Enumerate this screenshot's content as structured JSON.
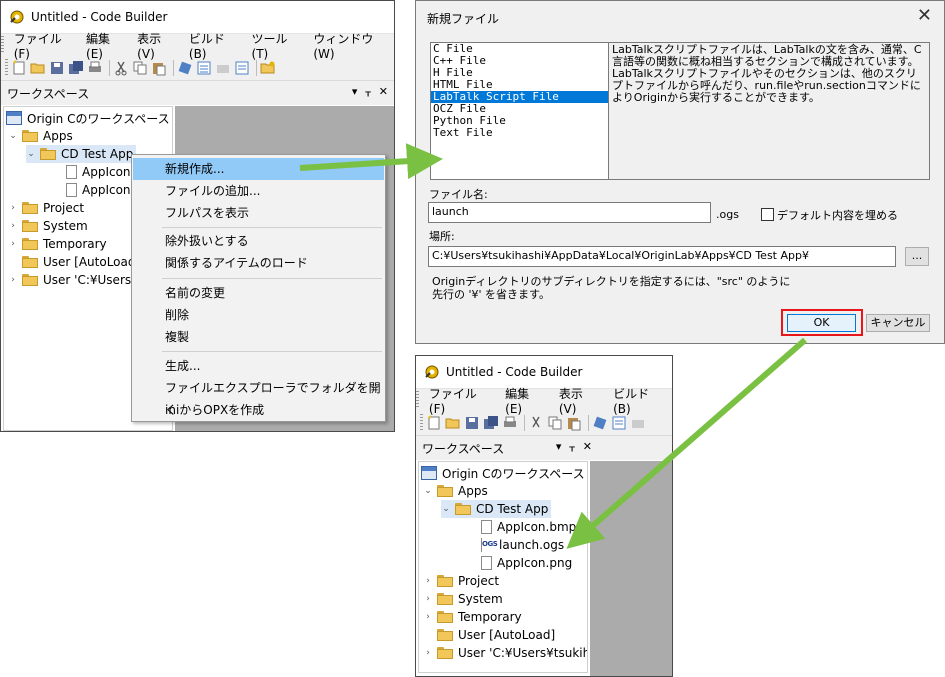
{
  "window1": {
    "title": "Untitled - Code Builder",
    "menu": [
      "ファイル(F)",
      "編集(E)",
      "表示(V)",
      "ビルド(B)",
      "ツール(T)",
      "ウィンドウ(W)"
    ],
    "panel_title": "ワークスペース",
    "panel_ctrl_dropdown": "▾",
    "panel_ctrl_pin": "ᅳ",
    "panel_ctrl_close": "✕",
    "tree": {
      "workspace": "Origin Cのワークスペース",
      "apps": "Apps",
      "cd_test_app": "CD Test App",
      "appicon1": "AppIcon",
      "appicon2": "AppIcon",
      "project": "Project",
      "system": "System",
      "temporary": "Temporary",
      "user_autoload": "User [AutoLoad",
      "user_path": "User 'C:¥Users¥ts"
    }
  },
  "context_menu": {
    "items": [
      "新規作成...",
      "ファイルの追加...",
      "フルパスを表示",
      "除外扱いとする",
      "関係するアイテムのロード",
      "名前の変更",
      "削除",
      "複製",
      "生成...",
      "ファイルエクスプローラでフォルダを開く",
      "iniからOPXを作成"
    ]
  },
  "dialog": {
    "title": "新規ファイル",
    "close": "✕",
    "file_types": [
      "C File",
      "C++ File",
      "H File",
      "HTML File",
      "LabTalk Script File",
      "OCZ File",
      "Python File",
      "Text File"
    ],
    "selected_index": 4,
    "description": "LabTalkスクリプトファイルは、LabTalkの文を含み、通常、C言語等の関数に概ね相当するセクションで構成されています。LabTalkスクリプトファイルやそのセクションは、他のスクリプトファイルから呼んだり、run.fileやrun.sectionコマンドによりOriginから実行することができます。",
    "filename_label": "ファイル名:",
    "filename_value": "launch",
    "extension": ".ogs",
    "default_content_label": "デフォルト内容を埋める",
    "location_label": "場所:",
    "location_value": "C:¥Users¥tsukihashi¥AppData¥Local¥OriginLab¥Apps¥CD Test App¥",
    "browse_label": "...",
    "hint_line1": "Originディレクトリのサブディレクトリを指定するには、\"src\" のように",
    "hint_line2": "先行の '¥' を省きます。",
    "ok_label": "OK",
    "cancel_label": "キャンセル"
  },
  "window2": {
    "title": "Untitled - Code Builder",
    "menu": [
      "ファイル(F)",
      "編集(E)",
      "表示(V)",
      "ビルド(B)"
    ],
    "panel_title": "ワークスペース",
    "tree": {
      "workspace": "Origin Cのワークスペース",
      "apps": "Apps",
      "cd_test_app": "CD Test App",
      "appicon_bmp": "AppIcon.bmp",
      "launch_ogs": "launch.ogs",
      "appicon_png": "AppIcon.png",
      "project": "Project",
      "system": "System",
      "temporary": "Temporary",
      "user_autoload": "User [AutoLoad]",
      "user_path": "User 'C:¥Users¥tsukihasl"
    },
    "ogs_badge": "OGS"
  },
  "colors": {
    "arrow": "#7ac143",
    "highlight_box": "#e8161b",
    "selection": "#0078d7",
    "menu_hover": "#91c9f7"
  }
}
